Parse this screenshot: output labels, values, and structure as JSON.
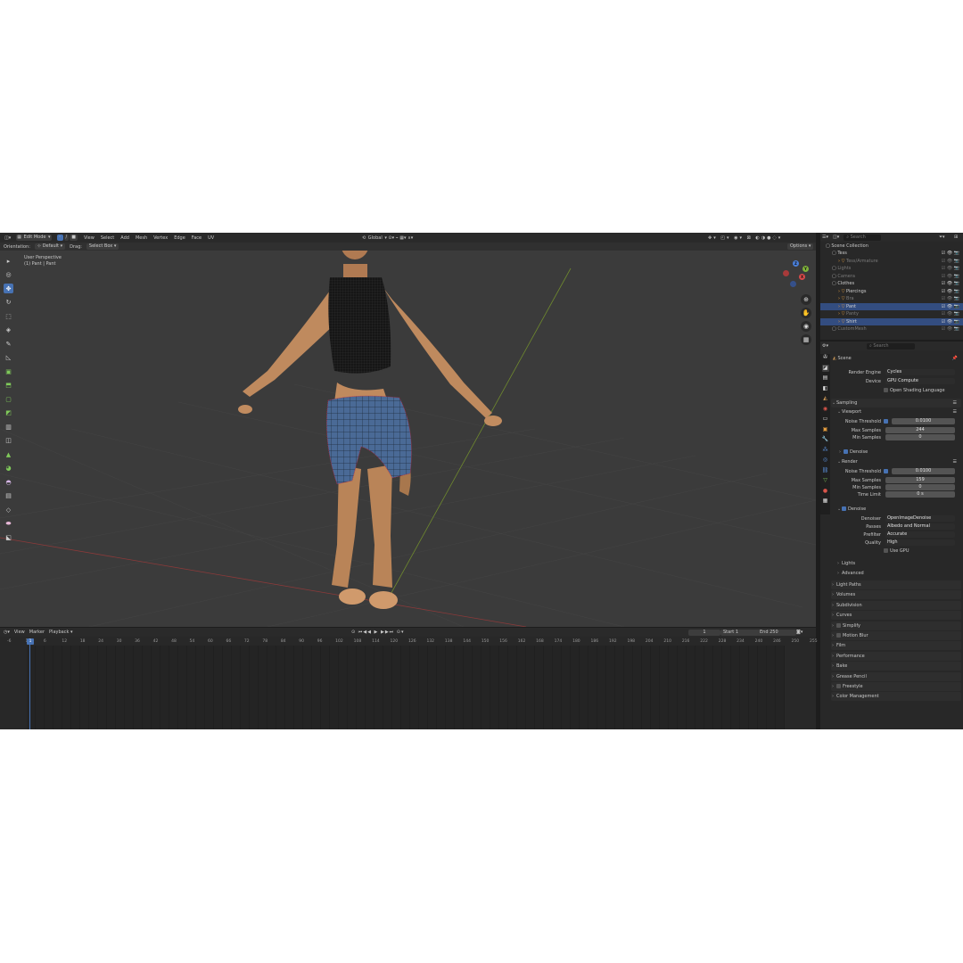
{
  "header": {
    "mode": "Edit Mode",
    "menus": [
      "View",
      "Select",
      "Add",
      "Mesh",
      "Vertex",
      "Edge",
      "Face",
      "UV"
    ],
    "transform_orientation": "Global",
    "options_label": "Options"
  },
  "tool_settings": {
    "orientation_label": "Orientation:",
    "orientation_value": "Default",
    "drag_label": "Drag:",
    "drag_value": "Select Box"
  },
  "viewport": {
    "perspective": "User Perspective",
    "object_info": "(1) Pant | Pant",
    "gizmo_axes": [
      "X",
      "Y",
      "Z"
    ]
  },
  "timeline": {
    "menus": [
      "View",
      "Marker",
      "Playback"
    ],
    "current_frame": "1",
    "start_label": "Start",
    "start_value": "1",
    "end_label": "End",
    "end_value": "250",
    "frame_ticks": [
      "-6",
      "1",
      "6",
      "12",
      "18",
      "24",
      "30",
      "36",
      "42",
      "48",
      "54",
      "60",
      "66",
      "72",
      "78",
      "84",
      "90",
      "96",
      "102",
      "108",
      "114",
      "120",
      "126",
      "132",
      "138",
      "144",
      "150",
      "156",
      "162",
      "168",
      "174",
      "180",
      "186",
      "192",
      "198",
      "204",
      "210",
      "216",
      "222",
      "228",
      "234",
      "240",
      "246",
      "250",
      "255"
    ]
  },
  "outliner": {
    "search_placeholder": "Search",
    "root": "Scene Collection",
    "items": [
      {
        "label": "Tess",
        "depth": 1,
        "state": "normal"
      },
      {
        "label": "Tess/Armature",
        "depth": 2,
        "state": "dim"
      },
      {
        "label": "Lights",
        "depth": 1,
        "state": "dim"
      },
      {
        "label": "Camera",
        "depth": 1,
        "state": "dim"
      },
      {
        "label": "Clothes",
        "depth": 1,
        "state": "normal"
      },
      {
        "label": "Piercings",
        "depth": 2,
        "state": "normal"
      },
      {
        "label": "Bra",
        "depth": 2,
        "state": "dim"
      },
      {
        "label": "Pant",
        "depth": 2,
        "state": "selected"
      },
      {
        "label": "Panty",
        "depth": 2,
        "state": "dim"
      },
      {
        "label": "Shirt",
        "depth": 2,
        "state": "selected"
      },
      {
        "label": "CustomMesh",
        "depth": 1,
        "state": "dim"
      }
    ]
  },
  "properties": {
    "search_placeholder": "Search",
    "context": "Scene",
    "render_engine_label": "Render Engine",
    "render_engine": "Cycles",
    "device_label": "Device",
    "device": "GPU Compute",
    "osl_label": "Open Shading Language",
    "sampling_label": "Sampling",
    "viewport_label": "Viewport",
    "v_noise_threshold_label": "Noise Threshold",
    "v_noise_threshold": "0.0100",
    "v_max_samples_label": "Max Samples",
    "v_max_samples": "244",
    "v_min_samples_label": "Min Samples",
    "v_min_samples": "0",
    "v_denoise_label": "Denoise",
    "render_label": "Render",
    "r_noise_threshold_label": "Noise Threshold",
    "r_noise_threshold": "0.0100",
    "r_max_samples_label": "Max Samples",
    "r_max_samples": "159",
    "r_min_samples_label": "Min Samples",
    "r_min_samples": "0",
    "r_time_limit_label": "Time Limit",
    "r_time_limit": "0 s",
    "r_denoise_label": "Denoise",
    "denoiser_label": "Denoiser",
    "denoiser": "OpenImageDenoise",
    "passes_label": "Passes",
    "passes": "Albedo and Normal",
    "prefilter_label": "Prefilter",
    "prefilter": "Accurate",
    "quality_label": "Quality",
    "quality": "High",
    "use_gpu_label": "Use GPU",
    "sub_lights": "Lights",
    "sub_advanced": "Advanced",
    "panels": [
      "Light Paths",
      "Volumes",
      "Subdivision",
      "Curves",
      "Simplify",
      "Motion Blur",
      "Film",
      "Performance",
      "Bake",
      "Grease Pencil",
      "Freestyle",
      "Color Management"
    ]
  },
  "colors": {
    "accent": "#4772b3",
    "viewport_bg": "#3b3b3b",
    "panel_bg": "#282828",
    "selection": "#334d80"
  }
}
